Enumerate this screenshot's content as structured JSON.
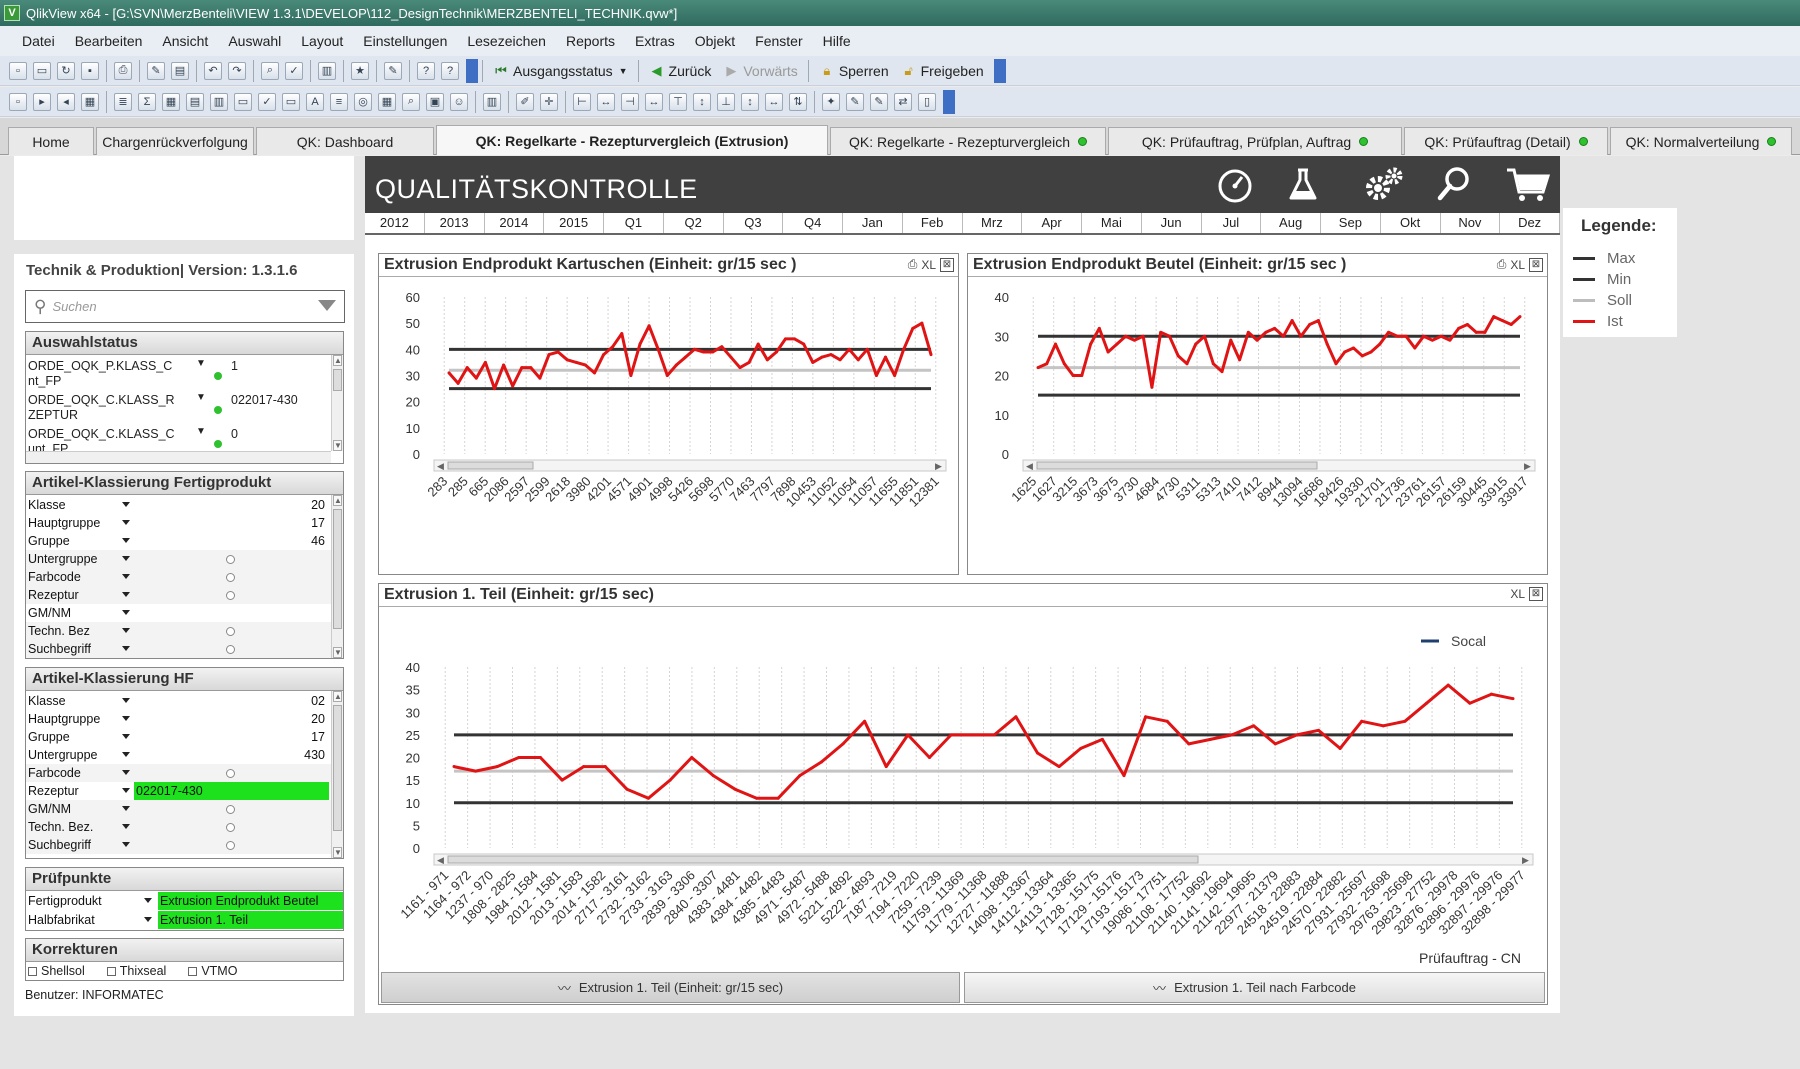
{
  "window": {
    "title": "QlikView x64 - [G:\\SVN\\MerzBenteli\\VIEW 1.3.1\\DEVELOP\\112_DesignTechnik\\MERZBENTELI_TECHNIK.qvw*]",
    "app_icon": "V"
  },
  "menu": [
    "Datei",
    "Bearbeiten",
    "Ansicht",
    "Auswahl",
    "Layout",
    "Einstellungen",
    "Lesezeichen",
    "Reports",
    "Extras",
    "Objekt",
    "Fenster",
    "Hilfe"
  ],
  "toolbar": {
    "ausgangsstatus": "Ausgangsstatus",
    "zurueck": "Zurück",
    "vorwaerts": "Vorwärts",
    "sperren": "Sperren",
    "freigeben": "Freigeben"
  },
  "tabs": [
    {
      "label": "Home"
    },
    {
      "label": "Chargenrückverfolgung"
    },
    {
      "label": "QK: Dashboard"
    },
    {
      "label": "QK: Regelkarte - Rezepturvergleich (Extrusion)"
    },
    {
      "label": "QK: Regelkarte - Rezepturvergleich"
    },
    {
      "label": "QK: Prüfauftrag, Prüfplan, Auftrag"
    },
    {
      "label": "QK: Prüfauftrag (Detail)"
    },
    {
      "label": "QK: Normalverteilung"
    }
  ],
  "sidebar": {
    "title": "Technik & Produktion| Version: 1.3.1.6",
    "search_placeholder": "Suchen",
    "auswahlstatus": {
      "title": "Auswahlstatus",
      "rows": [
        {
          "field": "ORDE_OQK_P.KLASS_C",
          "field2": "nt_FP",
          "value": "1"
        },
        {
          "field": "ORDE_OQK_C.KLASS_R",
          "field2": "ZEPTUR",
          "value": "022017-430"
        },
        {
          "field": "ORDE_OQK_C.KLASS_C",
          "field2": "unt_FP",
          "value": "0"
        }
      ]
    },
    "fertigprodukt": {
      "title": "Artikel-Klassierung  Fertigprodukt",
      "rows": [
        {
          "label": "Klasse",
          "value": "20"
        },
        {
          "label": "Hauptgruppe",
          "value": "17"
        },
        {
          "label": "Gruppe",
          "value": "46"
        },
        {
          "label": "Untergruppe",
          "value": ""
        },
        {
          "label": "Farbcode",
          "value": ""
        },
        {
          "label": "Rezeptur",
          "value": ""
        },
        {
          "label": "GM/NM",
          "value": ""
        },
        {
          "label": "Techn. Bez",
          "value": ""
        },
        {
          "label": "Suchbegriff",
          "value": ""
        }
      ]
    },
    "hf": {
      "title": "Artikel-Klassierung HF",
      "rows": [
        {
          "label": "Klasse",
          "value": "02"
        },
        {
          "label": "Hauptgruppe",
          "value": "20"
        },
        {
          "label": "Gruppe",
          "value": "17"
        },
        {
          "label": "Untergruppe",
          "value": "430"
        },
        {
          "label": "Farbcode",
          "value": ""
        },
        {
          "label": "Rezeptur",
          "value": "022017-430"
        },
        {
          "label": "GM/NM",
          "value": ""
        },
        {
          "label": "Techn. Bez.",
          "value": ""
        },
        {
          "label": "Suchbegriff",
          "value": ""
        }
      ]
    },
    "pruefpunkte": {
      "title": "Prüfpunkte",
      "rows": [
        {
          "label": "Fertigprodukt",
          "value": "Extrusion Endprodukt Beutel"
        },
        {
          "label": "Halbfabrikat",
          "value": "Extrusion 1. Teil"
        }
      ]
    },
    "korrekturen": {
      "title": "Korrekturen",
      "items": [
        "Shellsol",
        "Thixseal",
        "VTMO"
      ]
    },
    "user": "Benutzer: INFORMATEC"
  },
  "header": {
    "title": "QUALITÄTSKONTROLLE",
    "icons": [
      "dashboard-gauge-icon",
      "flask-icon",
      "gears-icon",
      "search-icon",
      "cart-icon"
    ],
    "timeline": [
      "2012",
      "2013",
      "2014",
      "2015",
      "Q1",
      "Q2",
      "Q3",
      "Q4",
      "Jan",
      "Feb",
      "Mrz",
      "Apr",
      "Mai",
      "Jun",
      "Jul",
      "Aug",
      "Sep",
      "Okt",
      "Nov",
      "Dez"
    ]
  },
  "legend": {
    "title": "Legende:",
    "items": [
      {
        "label": "Max",
        "color": "#333333"
      },
      {
        "label": "Min",
        "color": "#333333"
      },
      {
        "label": "Soll",
        "color": "#bdbdbd"
      },
      {
        "label": "Ist",
        "color": "#e01414"
      }
    ]
  },
  "chart_icons": {
    "xl": "XL"
  },
  "bottom_tabs": [
    "Extrusion 1. Teil (Einheit: gr/15 sec)",
    "Extrusion 1. Teil nach Farbcode"
  ],
  "chart_data": [
    {
      "type": "line",
      "title": "Extrusion Endprodukt Kartuschen (Einheit: gr/15 sec )",
      "ylim": [
        0,
        60
      ],
      "yticks": [
        0,
        10,
        20,
        30,
        40,
        50,
        60
      ],
      "categories": [
        "283",
        "285",
        "665",
        "2086",
        "2597",
        "2599",
        "2618",
        "3980",
        "4201",
        "4571",
        "4901",
        "4998",
        "5426",
        "5698",
        "5770",
        "7463",
        "7797",
        "7898",
        "10453",
        "11052",
        "11054",
        "11057",
        "11655",
        "11851",
        "12381"
      ],
      "max": 40,
      "min": 25,
      "soll": 32,
      "ist": [
        31,
        27,
        33,
        29,
        35,
        25,
        34,
        26,
        33,
        33,
        29,
        38,
        39,
        36,
        35,
        34,
        31,
        38,
        41,
        46,
        30,
        42,
        49,
        40,
        30,
        34,
        37,
        40,
        39,
        39,
        41,
        37,
        33,
        35,
        42,
        36,
        39,
        44,
        44,
        42,
        35,
        37,
        38,
        36,
        40,
        36,
        40,
        30,
        37,
        30,
        40,
        48,
        50,
        38
      ]
    },
    {
      "type": "line",
      "title": "Extrusion Endprodukt Beutel (Einheit: gr/15 sec )",
      "ylim": [
        0,
        40
      ],
      "yticks": [
        0,
        10,
        20,
        30,
        40
      ],
      "categories": [
        "1625",
        "1627",
        "3215",
        "3673",
        "3675",
        "3730",
        "4684",
        "4730",
        "5311",
        "5313",
        "7410",
        "7412",
        "8944",
        "13094",
        "16686",
        "18426",
        "19330",
        "21701",
        "21736",
        "23761",
        "26157",
        "26159",
        "30445",
        "33915",
        "33917"
      ],
      "max": 30,
      "min": 15,
      "soll": 22,
      "ist": [
        22,
        23,
        28,
        23,
        20,
        20,
        28,
        32,
        26,
        28,
        30,
        29,
        30,
        17,
        31,
        30,
        25,
        23,
        28,
        30,
        23,
        21,
        29,
        24,
        31,
        29,
        31,
        32,
        30,
        34,
        30,
        33,
        34,
        28,
        23,
        26,
        27,
        25,
        26,
        28,
        31,
        30,
        30,
        27,
        30,
        29,
        30,
        29,
        32,
        33,
        31,
        31,
        35,
        34,
        33,
        35
      ]
    },
    {
      "type": "line",
      "title": "Extrusion 1. Teil  (Einheit: gr/15 sec)",
      "ylim": [
        0,
        40
      ],
      "yticks": [
        0,
        5,
        10,
        15,
        20,
        25,
        30,
        35,
        40
      ],
      "series_legend": "Socal",
      "xlabel": "Prüfauftrag - CN",
      "categories": [
        "1161 - 971",
        "1164 - 972",
        "1237 - 970",
        "1808 - 2825",
        "1984 - 1584",
        "2012 - 1581",
        "2013 - 1583",
        "2014 - 1582",
        "2717 - 3161",
        "2732 - 3162",
        "2733 - 3163",
        "2839 - 3306",
        "2840 - 3307",
        "4383 - 4481",
        "4384 - 4482",
        "4385 - 4483",
        "4971 - 5487",
        "4972 - 5488",
        "5221 - 4892",
        "5222 - 4893",
        "7187 - 7219",
        "7194 - 7220",
        "7259 - 7239",
        "11759 - 11369",
        "11779 - 11368",
        "12727 - 11888",
        "14098 - 13367",
        "14112 - 13364",
        "14113 - 13365",
        "17128 - 15175",
        "17129 - 15176",
        "17193 - 15173",
        "19086 - 17751",
        "21108 - 17752",
        "21140 - 19692",
        "21141 - 19694",
        "21142 - 19695",
        "22977 - 21379",
        "24518 - 22883",
        "24519 - 22884",
        "24570 - 22882",
        "27931 - 25697",
        "27932 - 25698",
        "29763 - 25698",
        "29823 - 27752",
        "32876 - 29978",
        "32896 - 29976",
        "32897 - 29976",
        "32898 - 29977"
      ],
      "max": 25,
      "min": 10,
      "soll": 17,
      "ist": [
        18,
        17,
        18,
        20,
        20,
        15,
        18,
        18,
        13,
        11,
        15,
        20,
        16,
        13,
        11,
        11,
        16,
        19,
        23,
        28,
        18,
        25,
        20,
        25,
        25,
        25,
        29,
        21,
        18,
        22,
        24,
        16,
        29,
        28,
        23,
        24,
        25,
        27,
        23,
        25,
        26,
        22,
        28,
        27,
        28,
        32,
        36,
        32,
        34,
        33
      ]
    }
  ]
}
